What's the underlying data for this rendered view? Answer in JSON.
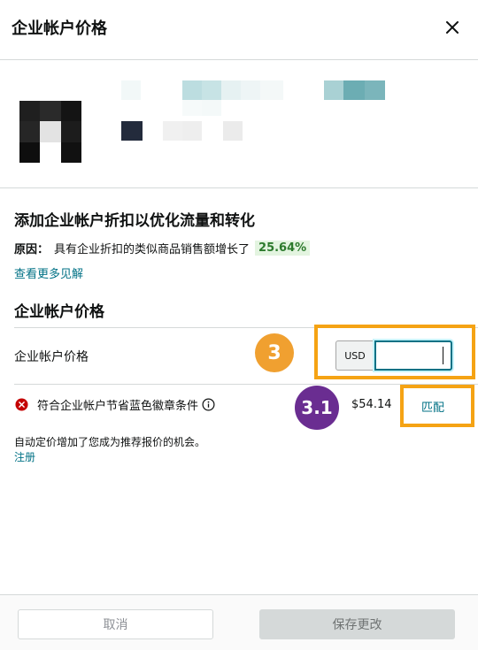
{
  "dialog": {
    "title": "企业帐户价格",
    "close_icon": "close-icon"
  },
  "insight": {
    "title": "添加企业帐户折扣以优化流量和转化",
    "reason_label": "原因：",
    "reason_text": "具有企业折扣的类似商品销售额增长了",
    "reason_percent": "25.64%",
    "see_more": "查看更多见解"
  },
  "business_price": {
    "section_title": "企业帐户价格",
    "field_label": "企业帐户价格",
    "currency": "USD",
    "value": "",
    "badge_step": "3"
  },
  "eligibility": {
    "text": "符合企业帐户节省蓝色徽章条件",
    "badge_step": "3.1",
    "price": "$54.14",
    "match_label": "匹配"
  },
  "auto_pricing": {
    "text": "自动定价增加了您成为推荐报价的机会。",
    "register_label": "注册"
  },
  "footer": {
    "cancel_label": "取消",
    "save_label": "保存更改"
  },
  "colors": {
    "highlight": "#f5a314",
    "badge_3": "#f0a030",
    "badge_31": "#6a2d91",
    "link": "#007185",
    "error": "#c40000"
  }
}
